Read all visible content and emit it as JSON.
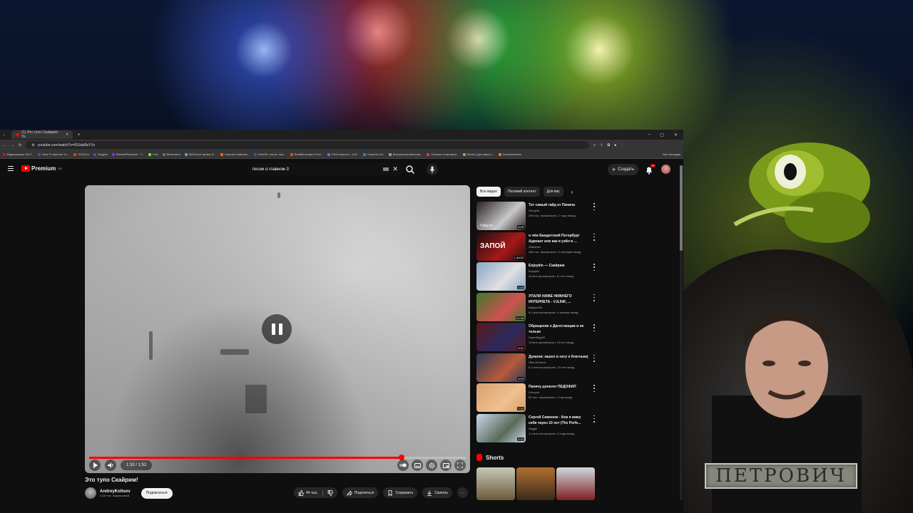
{
  "browser": {
    "tab_title": "(1) Это тупо Скайрим! - Yo",
    "new_tab": "+",
    "window_controls": [
      "–",
      "▢",
      "✕"
    ],
    "url": "youtube.com/watch?v=65Jdal9oY1o",
    "bookmarks": [
      "Видеозаписи: BUT...",
      "How To Improve Yo...",
      "OZON.ru",
      "Яндекс",
      "RichardPetrovich - T...",
      "Kick",
      "ВКонтакте",
      "BitTorrent трекер R...",
      "Горячие Новинки...",
      "Mail.Ru: почта, пои...",
      "RedditKroeger's Prof...",
      "РИА Новости - соб...",
      "Скачать DLL",
      "Интересная веселая...",
      "Сколько я как вера...",
      "Меню | Доставка п...",
      "DonationAlerts"
    ],
    "all_bookmarks": "Все закладки",
    "bookmark_colors": [
      "#ff0000",
      "#3b5998",
      "#ff3c00",
      "#2a5fd6",
      "#8a2be2",
      "#53fc18",
      "#4c75a3",
      "#4aa3ff",
      "#ff6600",
      "#1565c0",
      "#ff4500",
      "#7b61ff",
      "#1e88e5",
      "#999999",
      "#e53935",
      "#7cb342",
      "#f57c00"
    ]
  },
  "youtube": {
    "logo_text": "Premium",
    "logo_region": "RU",
    "search_query": "песни о главном 3",
    "create_label": "Создать",
    "notif_count": "9+"
  },
  "player": {
    "time": "1:33 / 1:52",
    "progress": 0.83
  },
  "video": {
    "title": "Это тупо Скайрим!",
    "channel": "AndreyKoltsov",
    "subscribers": "1,28 тыс. подписчиков",
    "subscribe_label": "Подписаться",
    "likes": "44 тыс.",
    "share_label": "Поделиться",
    "save_label": "Сохранить",
    "download_label": "Скачать"
  },
  "sidebar": {
    "chips": [
      "Все видео",
      "Похожий контент",
      "Для вас"
    ],
    "recommendations": [
      {
        "title": "Тот самый гайд от Папича",
        "channel": "Gorcpuir",
        "meta": "409 тыс. просмотров • 2 года назад",
        "duration": "6:08",
        "thumb_text": "Гайд по",
        "colors": [
          "#2a2020",
          "#c9c9c9"
        ]
      },
      {
        "title": "о чём Бандитский Петербург Адвокат или как я уэйл в ...",
        "channel": "Satsehen",
        "meta": "288 тыс. просмотров • 9 месяцев назад",
        "duration": "1:48:53",
        "thumb_text": "ЗАПОЙ",
        "colors": [
          "#1b1010",
          "#a81818"
        ]
      },
      {
        "title": "Enjoykin — Скайрим",
        "channel": "Enjoykin",
        "meta": "10 млн просмотров • 11 лет назад",
        "duration": "1:43",
        "thumb_text": "",
        "colors": [
          "#8aa5c8",
          "#e0e0e0"
        ]
      },
      {
        "title": "УПАЛИ НИЖЕ НИЖНЕГО ИНТЕРНЕТА - VJLINK, ...",
        "channel": "Bakyar404",
        "meta": "8,1 млн просмотров • 4 месяца назад",
        "duration": "21:38",
        "thumb_text": "",
        "colors": [
          "#3c7a2a",
          "#d05050"
        ]
      },
      {
        "title": "Обращение к Дагестанцам и не только",
        "channel": "SuperMag93",
        "meta": "13 млн просмотров • 13 лет назад",
        "duration": "6:41",
        "thumb_text": "",
        "colors": [
          "#5a1818",
          "#2a2a60"
        ]
      },
      {
        "title": "Дукалис зашел в хату к блатным)",
        "channel": "Gleb Ehrenus",
        "meta": "6,1 млн просмотров • 10 лет назад",
        "duration": "6:05",
        "thumb_text": "",
        "colors": [
          "#2a3a5a",
          "#b85a3a"
        ]
      },
      {
        "title": "Папичу донатит ПЕДОФИЛ",
        "channel": "Gorcpuir",
        "meta": "60 тыс. просмотров • 1 год назад",
        "duration": "7:21",
        "thumb_text": "",
        "colors": [
          "#d8a070",
          "#f0c090"
        ]
      },
      {
        "title": "Сергей Симонов - Кем я вижу себя через 10 лет (The Perfe...",
        "channel": "Wiggle",
        "meta": "1,1 млн просмотров • 3 года назад",
        "duration": "1:12",
        "thumb_text": "",
        "colors": [
          "#c8d8e8",
          "#5a6a5a"
        ]
      }
    ],
    "shorts_title": "Shorts",
    "shorts_colors": [
      [
        "#c8c8b8",
        "#6a5a3a"
      ],
      [
        "#b07030",
        "#3a2a1a"
      ],
      [
        "#d0d8e0",
        "#802020"
      ]
    ]
  },
  "overlay": {
    "nameplate": "ПЕТРОВИЧ"
  }
}
